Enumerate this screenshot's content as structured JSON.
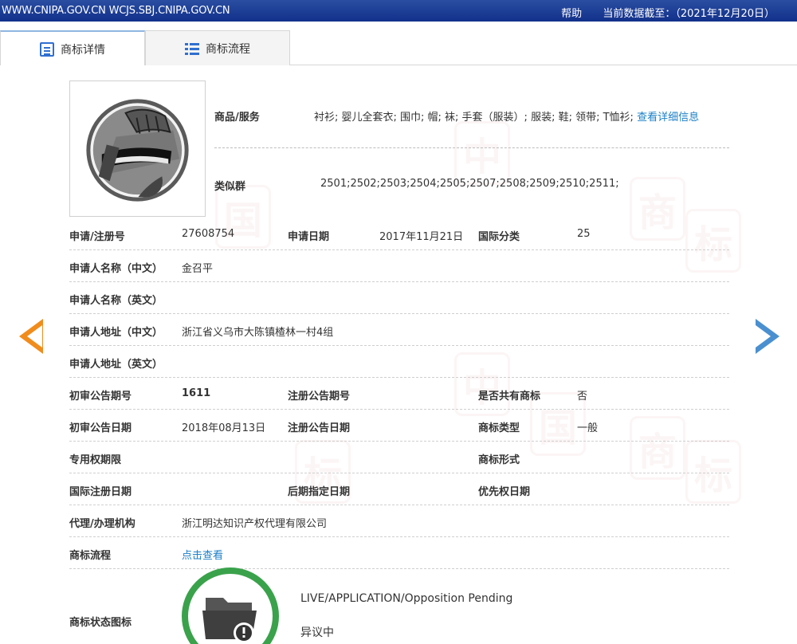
{
  "topbar": {
    "url": "WWW.CNIPA.GOV.CN WCJS.SBJ.CNIPA.GOV.CN",
    "help": "帮助",
    "data_date": "当前数据截至：（2021年12月20日）"
  },
  "tabs": [
    {
      "label": "商标详情",
      "icon": "document-icon",
      "active": true
    },
    {
      "label": "商标流程",
      "icon": "list-icon",
      "active": false
    }
  ],
  "goods": {
    "label": "商品/服务",
    "value": "衬衫; 婴儿全套衣; 围巾; 帽; 袜; 手套（服装）; 服装; 鞋; 领带; T恤衫;",
    "link": "查看详细信息"
  },
  "similar": {
    "label": "类似群",
    "value": "2501;2502;2503;2504;2505;2507;2508;2509;2510;2511;"
  },
  "rows": {
    "r1": {
      "l1": "申请/注册号",
      "v1": "27608754",
      "l2": "申请日期",
      "v2": "2017年11月21日",
      "l3": "国际分类",
      "v3": "25"
    },
    "r2": {
      "l1": "申请人名称（中文）",
      "v1": "金召平"
    },
    "r3": {
      "l1": "申请人名称（英文）"
    },
    "r4": {
      "l1": "申请人地址（中文）",
      "v1": "浙江省义乌市大陈镇楂林一村4组"
    },
    "r5": {
      "l1": "申请人地址（英文）"
    },
    "r6": {
      "l1": "初审公告期号",
      "v1": "1611",
      "l2": "注册公告期号",
      "l3": "是否共有商标",
      "v3": "否"
    },
    "r7": {
      "l1": "初审公告日期",
      "v1": "2018年08月13日",
      "l2": "注册公告日期",
      "l3": "商标类型",
      "v3": "一般"
    },
    "r8": {
      "l1": "专用权期限",
      "l3": "商标形式"
    },
    "r9": {
      "l1": "国际注册日期",
      "l2": "后期指定日期",
      "l3": "优先权日期"
    },
    "r10": {
      "l1": "代理/办理机构",
      "v1": "浙江明达知识产权代理有限公司"
    },
    "r11": {
      "l1": "商标流程",
      "v1": "点击查看"
    }
  },
  "status": {
    "label": "商标状态图标",
    "en": "LIVE/APPLICATION/Opposition Pending",
    "cn": "异议中"
  },
  "colors": {
    "topbar": "#1a3a94",
    "link": "#1a7fc7",
    "prev_arrow": "#f08c1c",
    "next_arrow": "#4a90d0",
    "status_ring": "#3aa24b"
  }
}
